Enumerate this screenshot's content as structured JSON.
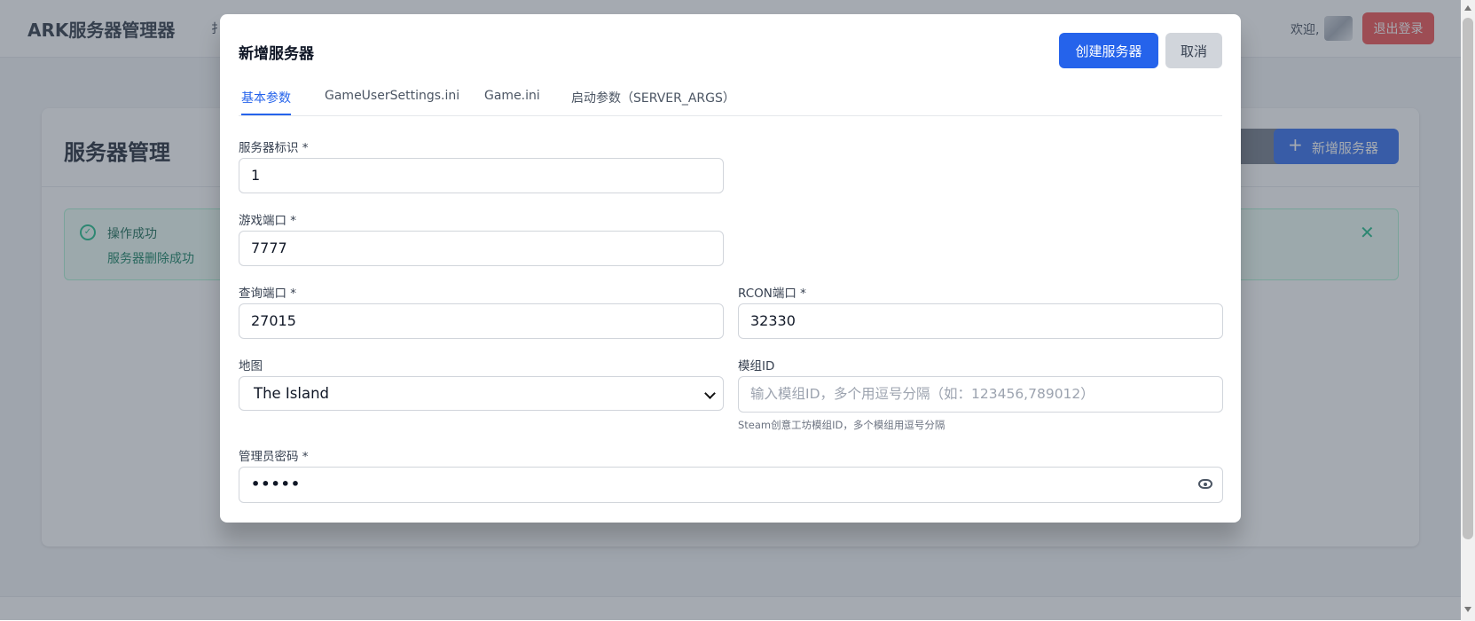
{
  "app": {
    "brand": "ARK服务器管理器",
    "nav_partial": "扌",
    "welcome": "欢迎,",
    "logout": "退出登录"
  },
  "page": {
    "title": "服务器管理",
    "dark_button_partial": "≡",
    "add_server_icon": "+",
    "add_server": "新增服务器"
  },
  "alert": {
    "icon": "check-circle-icon",
    "title": "操作成功",
    "message": "服务器删除成功",
    "close": "✕"
  },
  "modal": {
    "title": "新增服务器",
    "create_button": "创建服务器",
    "cancel_button": "取消",
    "tabs": [
      {
        "label": "基本参数",
        "active": true
      },
      {
        "label": "GameUserSettings.ini",
        "active": false
      },
      {
        "label": "Game.ini",
        "active": false
      },
      {
        "label": "启动参数（SERVER_ARGS）",
        "active": false
      }
    ],
    "fields": {
      "server_id": {
        "label": "服务器标识 *",
        "value": "1"
      },
      "game_port": {
        "label": "游戏端口 *",
        "value": "7777"
      },
      "query_port": {
        "label": "查询端口 *",
        "value": "27015"
      },
      "rcon_port": {
        "label": "RCON端口 *",
        "value": "32330"
      },
      "map": {
        "label": "地图",
        "value": "The Island"
      },
      "mod_ids": {
        "label": "模组ID",
        "value": "",
        "placeholder": "输入模组ID，多个用逗号分隔（如：123456,789012）",
        "hint": "Steam创意工坊模组ID，多个模组用逗号分隔"
      },
      "admin_password": {
        "label": "管理员密码 *",
        "value": "•••••"
      }
    }
  },
  "colors": {
    "primary": "#2563eb",
    "danger": "#ef4444",
    "success": "#10b981",
    "overlay": "rgba(75,85,99,0.5)"
  }
}
